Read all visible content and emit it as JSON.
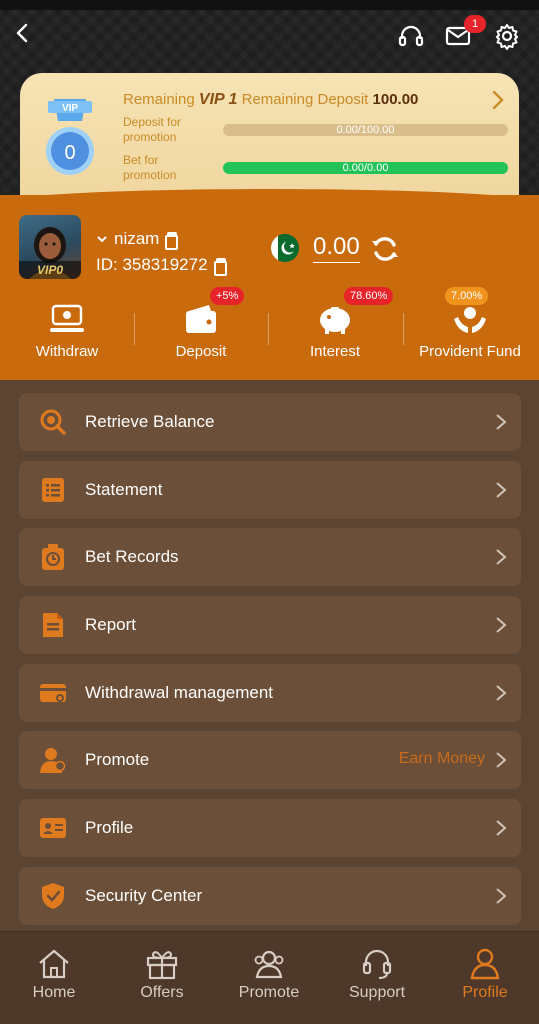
{
  "header": {
    "mail_badge": "1",
    "icons": [
      "back-icon",
      "headset-icon",
      "mail-icon",
      "gear-icon"
    ]
  },
  "vip": {
    "title_prefix": "Remaining",
    "level": "VIP 1",
    "title_mid": "Remaining Deposit",
    "remaining_deposit": "100.00",
    "medal_level": "0",
    "medal_text": "VIP",
    "deposit_label": "Deposit for promotion",
    "deposit_progress": "0.00/100.00",
    "deposit_fraction": 0,
    "bet_label": "Bet for promotion",
    "bet_progress": "0.00/0.00",
    "bet_fraction": 1
  },
  "user": {
    "vip_tag": "VIP0",
    "name": "nizam",
    "id_text": "ID: 358319272",
    "balance": "0.00"
  },
  "quick_actions": [
    {
      "label": "Withdraw",
      "icon": "withdraw-icon",
      "badge": ""
    },
    {
      "label": "Deposit",
      "icon": "wallet-icon",
      "badge": "+5%"
    },
    {
      "label": "Interest",
      "icon": "piggy-bank-icon",
      "badge": "78.60%"
    },
    {
      "label": "Provident Fund",
      "icon": "hands-coin-icon",
      "badge": "7.00%"
    }
  ],
  "menu": [
    {
      "label": "Retrieve Balance",
      "icon": "retrieve-icon",
      "extra": ""
    },
    {
      "label": "Statement",
      "icon": "statement-icon",
      "extra": ""
    },
    {
      "label": "Bet Records",
      "icon": "bet-records-icon",
      "extra": ""
    },
    {
      "label": "Report",
      "icon": "report-icon",
      "extra": ""
    },
    {
      "label": "Withdrawal management",
      "icon": "card-icon",
      "extra": ""
    },
    {
      "label": "Promote",
      "icon": "promote-icon",
      "extra": "Earn Money"
    },
    {
      "label": "Profile",
      "icon": "id-card-icon",
      "extra": ""
    },
    {
      "label": "Security Center",
      "icon": "shield-icon",
      "extra": ""
    }
  ],
  "bottom_nav": [
    {
      "label": "Home",
      "icon": "home-icon",
      "active": false
    },
    {
      "label": "Offers",
      "icon": "gift-icon",
      "active": false
    },
    {
      "label": "Promote",
      "icon": "users-icon",
      "active": false
    },
    {
      "label": "Support",
      "icon": "headset-icon",
      "active": false
    },
    {
      "label": "Profile",
      "icon": "user-icon",
      "active": true
    }
  ],
  "colors": {
    "accent": "#c96a0c",
    "active_nav": "#e07a1f",
    "badge_red": "#e8242b",
    "badge_orange": "#f0941e"
  }
}
